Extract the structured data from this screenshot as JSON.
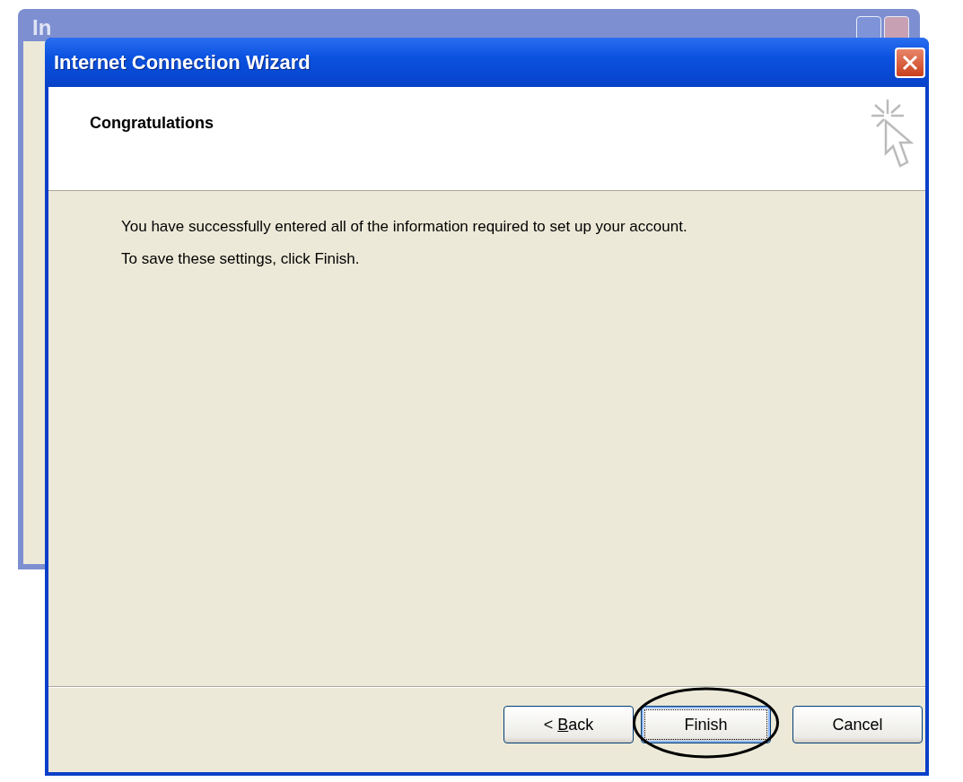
{
  "background_window": {
    "title": "In",
    "buttons": [
      {
        "kind": "help"
      },
      {
        "kind": "close"
      }
    ]
  },
  "wizard": {
    "title": "Internet Connection Wizard",
    "header": {
      "title": "Congratulations"
    },
    "paragraphs": [
      "You have successfully entered all of the information required to set up your account.",
      "To save these settings, click Finish."
    ],
    "buttons": [
      {
        "before": "< ",
        "access_key": "B",
        "after": "ack",
        "default": false,
        "circled": false
      },
      {
        "before": "Finish",
        "default": true,
        "circled": true
      },
      {
        "before": "Cancel",
        "default": false,
        "circled": false
      }
    ]
  }
}
